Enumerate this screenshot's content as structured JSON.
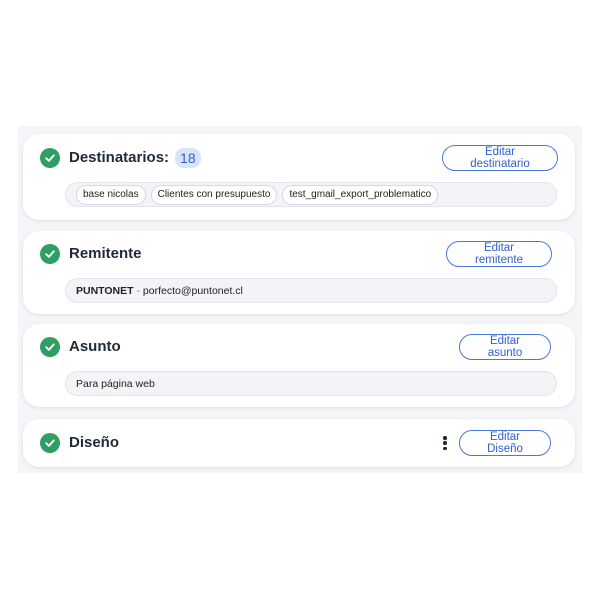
{
  "colors": {
    "check": "#2e9e63",
    "accent": "#2f5fd0",
    "badge_bg": "#d7e5fb",
    "panel_bg": "#f4f5f8"
  },
  "recipients": {
    "title": "Destinatarios:",
    "count": "18",
    "edit_label": "Editar destinatario",
    "tags": [
      "base nicolas",
      "Clientes con presupuesto",
      "test_gmail_export_problematico"
    ]
  },
  "sender": {
    "title": "Remitente",
    "edit_label": "Editar remitente",
    "name": "PUNTONET",
    "separator": " - ",
    "email": "porfecto@puntonet.cl"
  },
  "subject": {
    "title": "Asunto",
    "edit_label": "Editar asunto",
    "value": "Para página web"
  },
  "design": {
    "title": "Diseño",
    "edit_label": "Editar Diseño"
  }
}
